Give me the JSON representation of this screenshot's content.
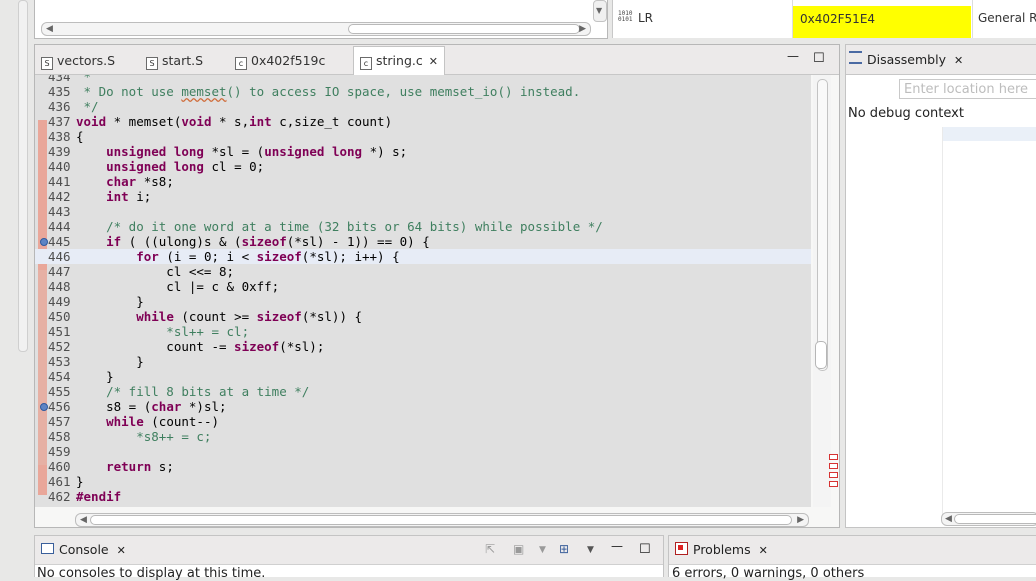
{
  "registers": {
    "icon": "binary-icon",
    "name": "LR",
    "value": "0x402F51E4",
    "group": "General R"
  },
  "editor": {
    "tabs": [
      {
        "label": "vectors.S",
        "icon": "S"
      },
      {
        "label": "start.S",
        "icon": "S"
      },
      {
        "label": "0x402f519c",
        "icon": "c"
      },
      {
        "label": "string.c",
        "icon": "c",
        "active": true
      }
    ],
    "close_glyph": "✕",
    "minimize_glyph": "—",
    "maximize_glyph": "☐",
    "lines": [
      {
        "n": "434",
        "t": " *"
      },
      {
        "n": "435",
        "t": " * Do not use memset() to access IO space, use memset_io() instead."
      },
      {
        "n": "436",
        "t": " */"
      },
      {
        "n": "437",
        "t": "void * memset(void * s,int c,size_t count)"
      },
      {
        "n": "438",
        "t": "{"
      },
      {
        "n": "439",
        "t": "    unsigned long *sl = (unsigned long *) s;"
      },
      {
        "n": "440",
        "t": "    unsigned long cl = 0;"
      },
      {
        "n": "441",
        "t": "    char *s8;"
      },
      {
        "n": "442",
        "t": "    int i;"
      },
      {
        "n": "443",
        "t": ""
      },
      {
        "n": "444",
        "t": "    /* do it one word at a time (32 bits or 64 bits) while possible */"
      },
      {
        "n": "445",
        "t": "    if ( ((ulong)s & (sizeof(*sl) - 1)) == 0) {"
      },
      {
        "n": "446",
        "t": "        for (i = 0; i < sizeof(*sl); i++) {"
      },
      {
        "n": "447",
        "t": "            cl <<= 8;"
      },
      {
        "n": "448",
        "t": "            cl |= c & 0xff;"
      },
      {
        "n": "449",
        "t": "        }"
      },
      {
        "n": "450",
        "t": "        while (count >= sizeof(*sl)) {"
      },
      {
        "n": "451",
        "t": "            *sl++ = cl;"
      },
      {
        "n": "452",
        "t": "            count -= sizeof(*sl);"
      },
      {
        "n": "453",
        "t": "        }"
      },
      {
        "n": "454",
        "t": "    }"
      },
      {
        "n": "455",
        "t": "    /* fill 8 bits at a time */"
      },
      {
        "n": "456",
        "t": "    s8 = (char *)sl;"
      },
      {
        "n": "457",
        "t": "    while (count--)"
      },
      {
        "n": "458",
        "t": "        *s8++ = c;"
      },
      {
        "n": "459",
        "t": ""
      },
      {
        "n": "460",
        "t": "    return s;"
      },
      {
        "n": "461",
        "t": "}"
      },
      {
        "n": "462",
        "t": "#endif"
      }
    ]
  },
  "disassembly": {
    "title": "Disassembly",
    "location_placeholder": "Enter location here",
    "message": "No debug context"
  },
  "console": {
    "title": "Console",
    "message": "No consoles to display at this time."
  },
  "problems": {
    "title": "Problems",
    "summary": "6 errors, 0 warnings, 0 others"
  }
}
